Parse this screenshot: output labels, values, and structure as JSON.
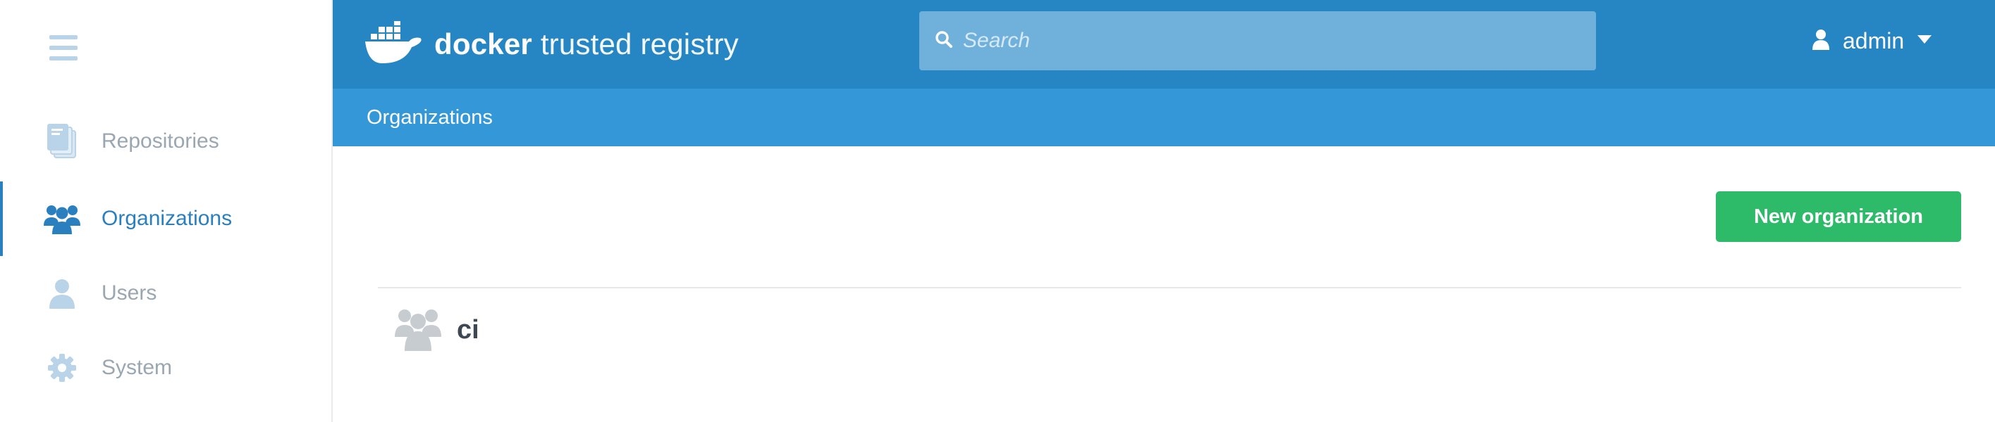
{
  "sidebar": {
    "menu_icon": "hamburger-menu-icon",
    "items": [
      {
        "label": "Repositories",
        "icon": "repositories-icon",
        "active": false
      },
      {
        "label": "Organizations",
        "icon": "organizations-icon",
        "active": true
      },
      {
        "label": "Users",
        "icon": "user-icon",
        "active": false
      },
      {
        "label": "System",
        "icon": "gear-icon",
        "active": false
      }
    ]
  },
  "header": {
    "logo_word_1": "docker",
    "logo_word_2": "trusted registry",
    "logo_icon": "docker-whale-icon",
    "search": {
      "placeholder": "Search",
      "value": "",
      "icon": "search-icon"
    },
    "user": {
      "name": "admin",
      "icon": "user-icon",
      "caret_icon": "caret-down-icon"
    }
  },
  "subheader": {
    "breadcrumb": "Organizations"
  },
  "main": {
    "new_org_button": "New organization",
    "organizations": [
      {
        "name": "ci",
        "icon": "organization-icon"
      }
    ]
  },
  "colors": {
    "topbar": "#2686c4",
    "subheader": "#3498d8",
    "accent": "#2a7fbf",
    "primary_button": "#2dbb6a",
    "sidebar_inactive": "#9aa7b1"
  }
}
